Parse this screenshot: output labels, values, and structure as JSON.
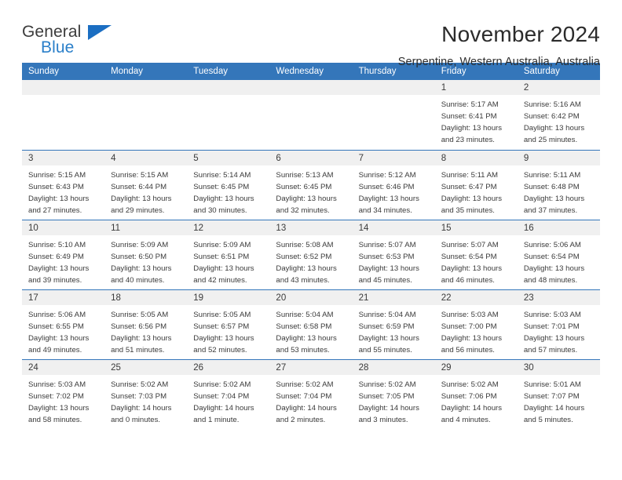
{
  "logo": {
    "word_top": "General",
    "word_bottom": "Blue",
    "triangle_icon": "blue-triangle-icon",
    "colors": {
      "dark": "#3c3c3c",
      "blue": "#2a7fc9",
      "triangle": "#1b6ec2"
    }
  },
  "header": {
    "title": "November 2024",
    "subtitle": "Serpentine, Western Australia, Australia"
  },
  "theme": {
    "header_blue": "#3476ba",
    "daynum_gray": "#f0f0f0",
    "text": "#3a3a3a"
  },
  "calendar": {
    "weekday_headers": [
      "Sunday",
      "Monday",
      "Tuesday",
      "Wednesday",
      "Thursday",
      "Friday",
      "Saturday"
    ],
    "labels": {
      "sunrise": "Sunrise:",
      "sunset": "Sunset:",
      "daylight": "Daylight:"
    },
    "weeks": [
      [
        {
          "day": ""
        },
        {
          "day": ""
        },
        {
          "day": ""
        },
        {
          "day": ""
        },
        {
          "day": ""
        },
        {
          "day": "1",
          "sunrise": "Sunrise: 5:17 AM",
          "sunset": "Sunset: 6:41 PM",
          "daylight_1": "Daylight: 13 hours",
          "daylight_2": "and 23 minutes."
        },
        {
          "day": "2",
          "sunrise": "Sunrise: 5:16 AM",
          "sunset": "Sunset: 6:42 PM",
          "daylight_1": "Daylight: 13 hours",
          "daylight_2": "and 25 minutes."
        }
      ],
      [
        {
          "day": "3",
          "sunrise": "Sunrise: 5:15 AM",
          "sunset": "Sunset: 6:43 PM",
          "daylight_1": "Daylight: 13 hours",
          "daylight_2": "and 27 minutes."
        },
        {
          "day": "4",
          "sunrise": "Sunrise: 5:15 AM",
          "sunset": "Sunset: 6:44 PM",
          "daylight_1": "Daylight: 13 hours",
          "daylight_2": "and 29 minutes."
        },
        {
          "day": "5",
          "sunrise": "Sunrise: 5:14 AM",
          "sunset": "Sunset: 6:45 PM",
          "daylight_1": "Daylight: 13 hours",
          "daylight_2": "and 30 minutes."
        },
        {
          "day": "6",
          "sunrise": "Sunrise: 5:13 AM",
          "sunset": "Sunset: 6:45 PM",
          "daylight_1": "Daylight: 13 hours",
          "daylight_2": "and 32 minutes."
        },
        {
          "day": "7",
          "sunrise": "Sunrise: 5:12 AM",
          "sunset": "Sunset: 6:46 PM",
          "daylight_1": "Daylight: 13 hours",
          "daylight_2": "and 34 minutes."
        },
        {
          "day": "8",
          "sunrise": "Sunrise: 5:11 AM",
          "sunset": "Sunset: 6:47 PM",
          "daylight_1": "Daylight: 13 hours",
          "daylight_2": "and 35 minutes."
        },
        {
          "day": "9",
          "sunrise": "Sunrise: 5:11 AM",
          "sunset": "Sunset: 6:48 PM",
          "daylight_1": "Daylight: 13 hours",
          "daylight_2": "and 37 minutes."
        }
      ],
      [
        {
          "day": "10",
          "sunrise": "Sunrise: 5:10 AM",
          "sunset": "Sunset: 6:49 PM",
          "daylight_1": "Daylight: 13 hours",
          "daylight_2": "and 39 minutes."
        },
        {
          "day": "11",
          "sunrise": "Sunrise: 5:09 AM",
          "sunset": "Sunset: 6:50 PM",
          "daylight_1": "Daylight: 13 hours",
          "daylight_2": "and 40 minutes."
        },
        {
          "day": "12",
          "sunrise": "Sunrise: 5:09 AM",
          "sunset": "Sunset: 6:51 PM",
          "daylight_1": "Daylight: 13 hours",
          "daylight_2": "and 42 minutes."
        },
        {
          "day": "13",
          "sunrise": "Sunrise: 5:08 AM",
          "sunset": "Sunset: 6:52 PM",
          "daylight_1": "Daylight: 13 hours",
          "daylight_2": "and 43 minutes."
        },
        {
          "day": "14",
          "sunrise": "Sunrise: 5:07 AM",
          "sunset": "Sunset: 6:53 PM",
          "daylight_1": "Daylight: 13 hours",
          "daylight_2": "and 45 minutes."
        },
        {
          "day": "15",
          "sunrise": "Sunrise: 5:07 AM",
          "sunset": "Sunset: 6:54 PM",
          "daylight_1": "Daylight: 13 hours",
          "daylight_2": "and 46 minutes."
        },
        {
          "day": "16",
          "sunrise": "Sunrise: 5:06 AM",
          "sunset": "Sunset: 6:54 PM",
          "daylight_1": "Daylight: 13 hours",
          "daylight_2": "and 48 minutes."
        }
      ],
      [
        {
          "day": "17",
          "sunrise": "Sunrise: 5:06 AM",
          "sunset": "Sunset: 6:55 PM",
          "daylight_1": "Daylight: 13 hours",
          "daylight_2": "and 49 minutes."
        },
        {
          "day": "18",
          "sunrise": "Sunrise: 5:05 AM",
          "sunset": "Sunset: 6:56 PM",
          "daylight_1": "Daylight: 13 hours",
          "daylight_2": "and 51 minutes."
        },
        {
          "day": "19",
          "sunrise": "Sunrise: 5:05 AM",
          "sunset": "Sunset: 6:57 PM",
          "daylight_1": "Daylight: 13 hours",
          "daylight_2": "and 52 minutes."
        },
        {
          "day": "20",
          "sunrise": "Sunrise: 5:04 AM",
          "sunset": "Sunset: 6:58 PM",
          "daylight_1": "Daylight: 13 hours",
          "daylight_2": "and 53 minutes."
        },
        {
          "day": "21",
          "sunrise": "Sunrise: 5:04 AM",
          "sunset": "Sunset: 6:59 PM",
          "daylight_1": "Daylight: 13 hours",
          "daylight_2": "and 55 minutes."
        },
        {
          "day": "22",
          "sunrise": "Sunrise: 5:03 AM",
          "sunset": "Sunset: 7:00 PM",
          "daylight_1": "Daylight: 13 hours",
          "daylight_2": "and 56 minutes."
        },
        {
          "day": "23",
          "sunrise": "Sunrise: 5:03 AM",
          "sunset": "Sunset: 7:01 PM",
          "daylight_1": "Daylight: 13 hours",
          "daylight_2": "and 57 minutes."
        }
      ],
      [
        {
          "day": "24",
          "sunrise": "Sunrise: 5:03 AM",
          "sunset": "Sunset: 7:02 PM",
          "daylight_1": "Daylight: 13 hours",
          "daylight_2": "and 58 minutes."
        },
        {
          "day": "25",
          "sunrise": "Sunrise: 5:02 AM",
          "sunset": "Sunset: 7:03 PM",
          "daylight_1": "Daylight: 14 hours",
          "daylight_2": "and 0 minutes."
        },
        {
          "day": "26",
          "sunrise": "Sunrise: 5:02 AM",
          "sunset": "Sunset: 7:04 PM",
          "daylight_1": "Daylight: 14 hours",
          "daylight_2": "and 1 minute."
        },
        {
          "day": "27",
          "sunrise": "Sunrise: 5:02 AM",
          "sunset": "Sunset: 7:04 PM",
          "daylight_1": "Daylight: 14 hours",
          "daylight_2": "and 2 minutes."
        },
        {
          "day": "28",
          "sunrise": "Sunrise: 5:02 AM",
          "sunset": "Sunset: 7:05 PM",
          "daylight_1": "Daylight: 14 hours",
          "daylight_2": "and 3 minutes."
        },
        {
          "day": "29",
          "sunrise": "Sunrise: 5:02 AM",
          "sunset": "Sunset: 7:06 PM",
          "daylight_1": "Daylight: 14 hours",
          "daylight_2": "and 4 minutes."
        },
        {
          "day": "30",
          "sunrise": "Sunrise: 5:01 AM",
          "sunset": "Sunset: 7:07 PM",
          "daylight_1": "Daylight: 14 hours",
          "daylight_2": "and 5 minutes."
        }
      ]
    ]
  }
}
